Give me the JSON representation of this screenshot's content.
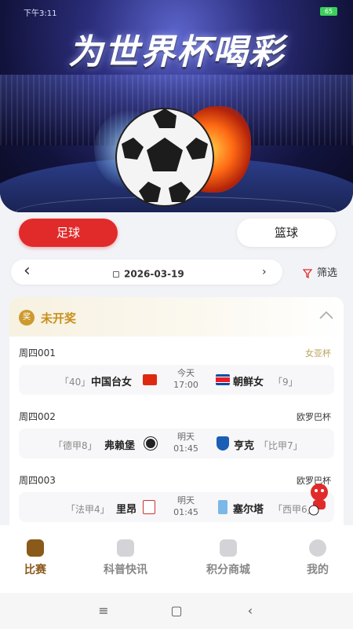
{
  "status": {
    "time": "下午3:11",
    "battery": "65"
  },
  "banner": {
    "title": "为世界杯喝彩"
  },
  "tabs": {
    "football": "足球",
    "basketball": "篮球"
  },
  "date_bar": {
    "date": "2026-03-19",
    "filter_label": "筛选"
  },
  "section": {
    "icon_text": "奖",
    "title": "未开奖"
  },
  "matches": [
    {
      "label": "周四001",
      "league": "女亚杯",
      "league_color": "#b8a25a",
      "home_rank": "「40」",
      "home_team": "中国台女",
      "home_flag": "china",
      "time_day": "今天",
      "time_clock": "17:00",
      "away_team": "朝鲜女",
      "away_rank": "「9」",
      "away_flag": "north-korea"
    },
    {
      "label": "周四002",
      "league": "欧罗巴杯",
      "league_color": "#333333",
      "home_rank": "「德甲8」",
      "home_team": "弗赖堡",
      "home_flag": "freiburg-crest",
      "time_day": "明天",
      "time_clock": "01:45",
      "away_team": "亨克",
      "away_rank": "「比甲7」",
      "away_flag": "genk-crest"
    },
    {
      "label": "周四003",
      "league": "欧罗巴杯",
      "league_color": "#333333",
      "home_rank": "「法甲4」",
      "home_team": "里昂",
      "home_flag": "lyon-crest",
      "time_day": "明天",
      "time_clock": "01:45",
      "away_team": "塞尔塔",
      "away_rank": "「西甲6」",
      "away_flag": "celta-crest"
    }
  ],
  "nav": [
    {
      "label": "比赛",
      "icon": "match-icon",
      "active": true
    },
    {
      "label": "科普快讯",
      "icon": "news-icon",
      "active": false
    },
    {
      "label": "积分商城",
      "icon": "shop-icon",
      "active": false
    },
    {
      "label": "我的",
      "icon": "profile-icon",
      "active": false
    }
  ],
  "colors": {
    "accent_red": "#e12a2a",
    "gold": "#c8901b",
    "nav_active": "#8a5a1a"
  }
}
